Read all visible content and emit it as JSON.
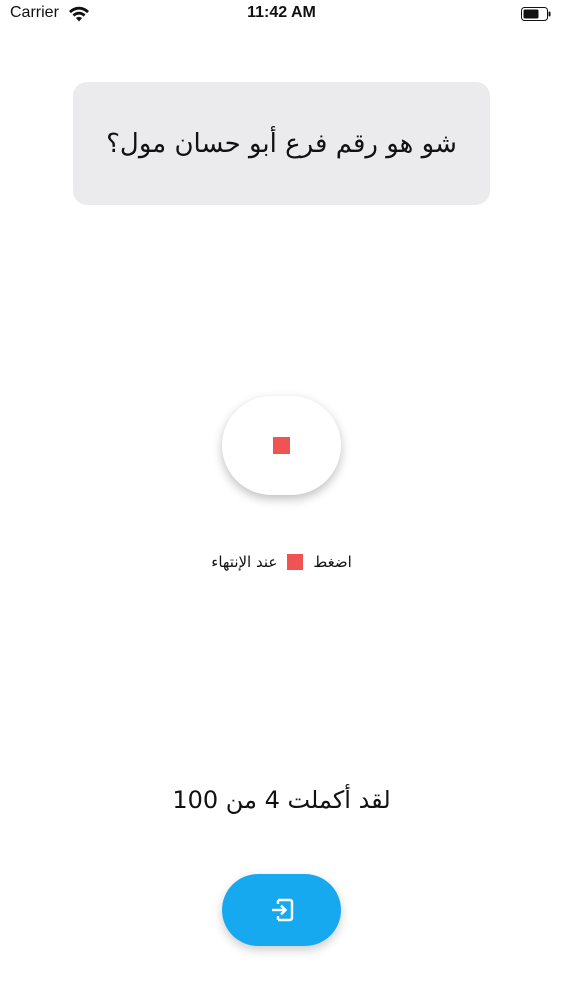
{
  "status_bar": {
    "carrier": "Carrier",
    "time": "11:42 AM",
    "wifi_icon": "wifi-icon",
    "battery_icon": "battery-icon"
  },
  "question": {
    "text": "شو هو رقم فرع أبو حسان مول؟"
  },
  "record": {
    "stop_icon": "stop-icon",
    "stop_color": "#f05353"
  },
  "instruction": {
    "press_label": "اضغط",
    "on_finish_label": "عند الإنتهاء"
  },
  "progress": {
    "text": "لقد أكملت 4 من 100",
    "completed": 4,
    "total": 100
  },
  "submit": {
    "icon": "login-icon",
    "color": "#17a9ef"
  }
}
